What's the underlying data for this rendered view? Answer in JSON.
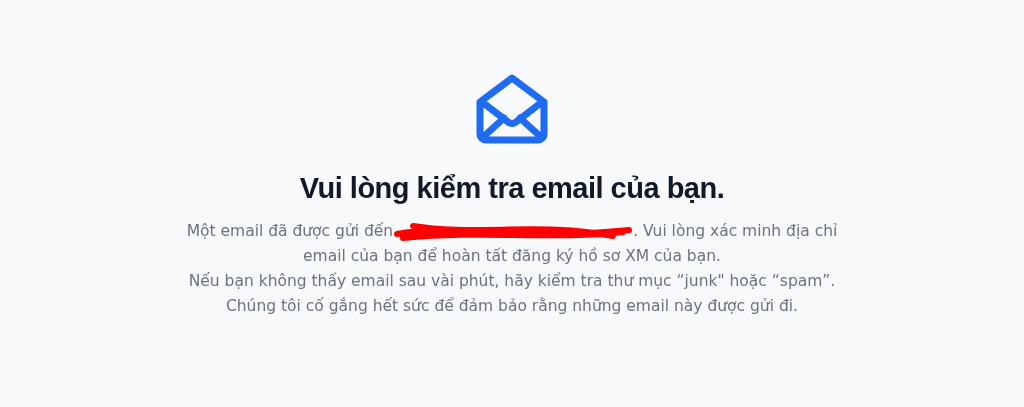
{
  "heading": "Vui lòng kiểm tra email của bạn.",
  "message_lines": [
    {
      "kind": "redacted",
      "before": "Một email đã được gửi đến",
      "after": ". Vui lòng xác minh địa chỉ"
    },
    {
      "kind": "text",
      "text": "email của bạn để hoàn tất đăng ký hồ sơ XM của bạn."
    },
    {
      "kind": "text",
      "text": "Nếu bạn không thấy email sau vài phút, hãy kiểm tra thư mục “junk\" hoặc “spam”."
    },
    {
      "kind": "text",
      "text": "Chúng tôi cố gắng hết sức để đảm bảo rằng những email này được gửi đi."
    }
  ]
}
